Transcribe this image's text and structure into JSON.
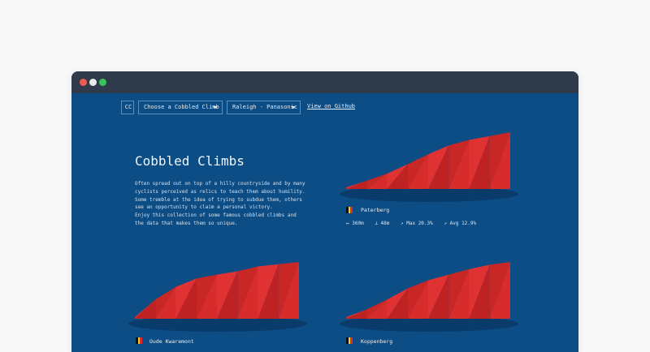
{
  "nav": {
    "logo": "CC",
    "climb_select": "Choose a Cobbled Climb",
    "team_select": "Raleigh - Panasonic",
    "github_link": "View on Github"
  },
  "hero": {
    "title": "Cobbled Climbs",
    "paragraph_1": "Often spread out on top of a hilly countryside and by many cyclists perceived as relics to teach them about humility. Some tremble at the idea of trying to subdue them, others see an opportunity to claim a personal victory.",
    "paragraph_2": "Enjoy this collection of some famous cobbled climbs and the data that makes them so unique."
  },
  "climbs": [
    {
      "name": "Paterberg",
      "distance": "360m",
      "elevation": "48m",
      "max_gradient": "Max 20.3%",
      "avg_gradient": "Avg 12.9%",
      "icons": {
        "distance": "distance-icon",
        "elevation": "elevation-icon",
        "max": "trend-up-icon",
        "avg": "trend-up-icon"
      },
      "profile": [
        0,
        0.12,
        0.25,
        0.42,
        0.6,
        0.76,
        0.86,
        0.93,
        1
      ]
    },
    {
      "name": "Oude Kwaremont",
      "profile": [
        0,
        0.32,
        0.55,
        0.7,
        0.77,
        0.83,
        0.92,
        0.96,
        1
      ]
    },
    {
      "name": "Koppenberg",
      "profile": [
        0,
        0.14,
        0.32,
        0.52,
        0.67,
        0.77,
        0.87,
        0.95,
        1
      ]
    }
  ],
  "colors": {
    "background": "#0c4d85",
    "profile_fill": "#d72b2b",
    "window_bar": "#2f3b4a",
    "flag_black": "#111111",
    "flag_yellow": "#f6d12a",
    "flag_red": "#e02a2a"
  }
}
